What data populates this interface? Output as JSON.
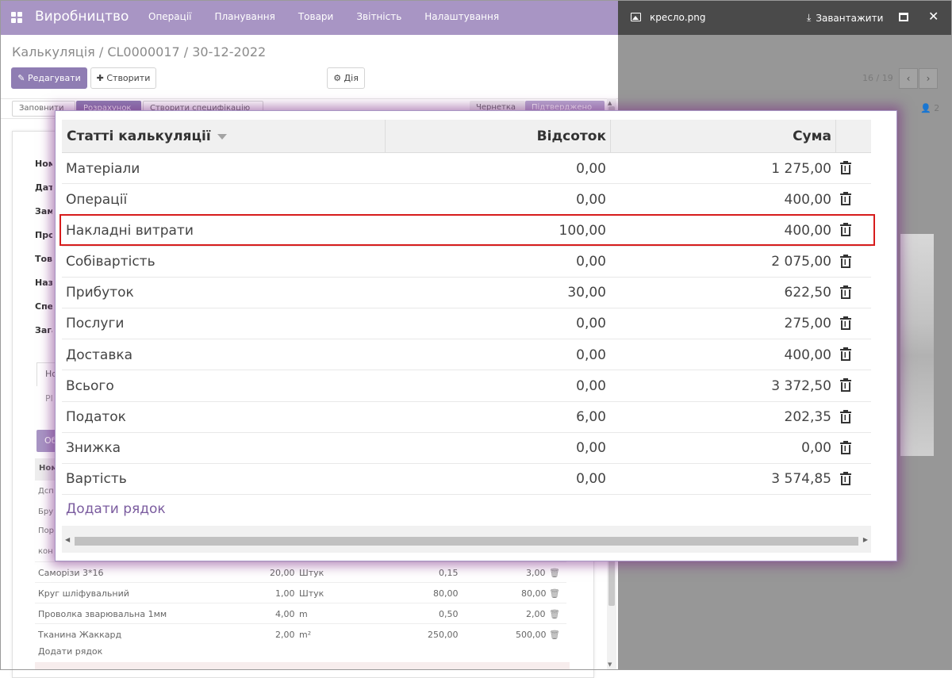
{
  "navbar": {
    "app_name": "Виробництво",
    "menu": [
      "Операції",
      "Планування",
      "Товари",
      "Звітність",
      "Налаштування"
    ]
  },
  "form": {
    "breadcrumb": "Калькуляція / CL0000017 / 30-12-2022",
    "edit_label": "✎ Редагувати",
    "create_label": "✚ Створити",
    "action_label": "⚙ Дія",
    "secondary_buttons": [
      "Заповнити",
      "Розрахунок",
      "Створити специфікацію",
      "Чернетка",
      "Підтверджено"
    ],
    "side_labels": [
      "Ном",
      "Дата",
      "Замо",
      "Прод",
      "Това",
      "Назв",
      "Спец",
      "Зага"
    ],
    "tab_label": "Но",
    "tab_sub": "Pl",
    "section_button": "Об",
    "lines_header": "Ном",
    "line_labels": [
      "Дсп",
      "Бру",
      "Пор",
      "кон"
    ],
    "items": [
      {
        "name": "Саморізи 3*16",
        "qty": "20,00",
        "uom": "Штук",
        "price": "0,15",
        "sum": "3,00"
      },
      {
        "name": "Круг шліфувальний",
        "qty": "1,00",
        "uom": "Штук",
        "price": "80,00",
        "sum": "80,00"
      },
      {
        "name": "Проволка зварювальна 1мм",
        "qty": "4,00",
        "uom": "m",
        "price": "0,50",
        "sum": "2,00"
      },
      {
        "name": "Тканина Жаккард",
        "qty": "2,00",
        "uom": "m²",
        "price": "250,00",
        "sum": "500,00"
      }
    ],
    "add_line": "Додати рядок"
  },
  "viewer": {
    "file_name": "кресло.png",
    "download_label": "Завантажити",
    "pager": "16 / 19",
    "chatter_followers": "2"
  },
  "modal": {
    "columns": {
      "name": "Статті калькуляції",
      "percent": "Відсоток",
      "sum": "Сума"
    },
    "rows": [
      {
        "name": "Матеріали",
        "percent": "0,00",
        "sum": "1 275,00"
      },
      {
        "name": "Операції",
        "percent": "0,00",
        "sum": "400,00"
      },
      {
        "name": "Накладні витрати",
        "percent": "100,00",
        "sum": "400,00"
      },
      {
        "name": "Собівартість",
        "percent": "0,00",
        "sum": "2 075,00"
      },
      {
        "name": "Прибуток",
        "percent": "30,00",
        "sum": "622,50"
      },
      {
        "name": "Послуги",
        "percent": "0,00",
        "sum": "275,00"
      },
      {
        "name": "Доставка",
        "percent": "0,00",
        "sum": "400,00"
      },
      {
        "name": "Всього",
        "percent": "0,00",
        "sum": "3 372,50"
      },
      {
        "name": "Податок",
        "percent": "6,00",
        "sum": "202,35"
      },
      {
        "name": "Знижка",
        "percent": "0,00",
        "sum": "0,00"
      },
      {
        "name": "Вартість",
        "percent": "0,00",
        "sum": "3 574,85"
      }
    ],
    "add_row": "Додати рядок",
    "highlighted_row": "Накладні витрати"
  },
  "colors": {
    "navbar": "#a895c4",
    "primary": "#8f7db3",
    "highlight_border": "#d71c1c",
    "link": "#7b5c9f"
  }
}
